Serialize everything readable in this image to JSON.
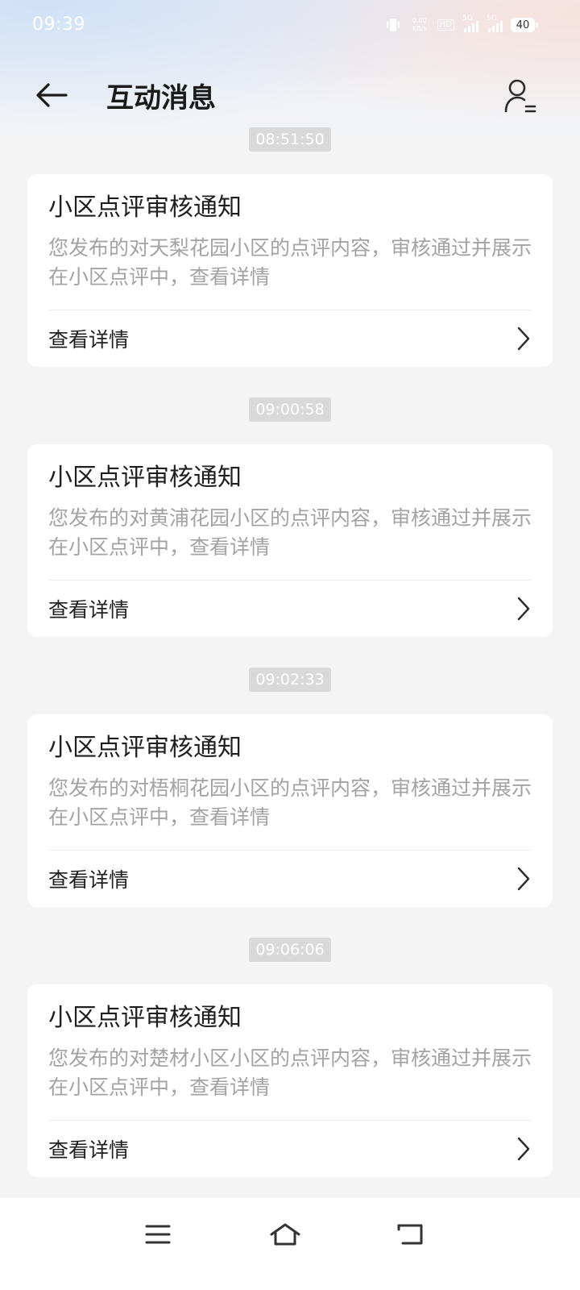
{
  "status_bar": {
    "time": "09:39",
    "net_speed_value": "0.00",
    "net_speed_unit": "KB/s",
    "hd_label": "HD",
    "signal_1_label": "5G",
    "signal_2_label": "5G",
    "battery_level": "40"
  },
  "header": {
    "title": "互动消息",
    "back_icon": "arrow-left-icon",
    "profile_icon": "user-list-icon"
  },
  "messages": [
    {
      "time": "08:51:50",
      "title": "小区点评审核通知",
      "description": "您发布的对天梨花园小区的点评内容，审核通过并展示在小区点评中，查看详情",
      "action_label": "查看详情"
    },
    {
      "time": "09:00:58",
      "title": "小区点评审核通知",
      "description": "您发布的对黄浦花园小区的点评内容，审核通过并展示在小区点评中，查看详情",
      "action_label": "查看详情"
    },
    {
      "time": "09:02:33",
      "title": "小区点评审核通知",
      "description": "您发布的对梧桐花园小区的点评内容，审核通过并展示在小区点评中，查看详情",
      "action_label": "查看详情"
    },
    {
      "time": "09:06:06",
      "title": "小区点评审核通知",
      "description": "您发布的对楚材小区小区的点评内容，审核通过并展示在小区点评中，查看详情",
      "action_label": "查看详情"
    }
  ],
  "nav_bar": {
    "menu_icon": "menu-icon",
    "home_icon": "home-icon",
    "back_icon": "return-icon"
  },
  "colors": {
    "background": "#f4f4f5",
    "card": "#ffffff",
    "title_text": "#1b1b1b",
    "secondary_text": "#a3a3a3",
    "time_badge": "#d9d9d9"
  }
}
